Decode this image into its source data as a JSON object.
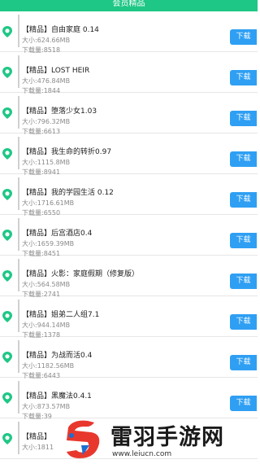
{
  "header": {
    "title": "会员精品"
  },
  "download_label": "下载",
  "colors": {
    "header_bg": "#1ec785",
    "button_bg": "#2f9ff3",
    "pin": "#1ec785"
  },
  "items": [
    {
      "name": "【精品】自由家庭 0.14",
      "size": "大小:624.66MB",
      "downloads": "下载量:8518"
    },
    {
      "name": "【精品】LOST HEIR",
      "size": "大小:476.84MB",
      "downloads": "下载量:1844"
    },
    {
      "name": "【精品】堕落少女1.03",
      "size": "大小:796.32MB",
      "downloads": "下载量:6613"
    },
    {
      "name": "【精品】我生命的转折0.97",
      "size": "大小:1115.8MB",
      "downloads": "下载量:8941"
    },
    {
      "name": "【精品】我的学园生活 0.12",
      "size": "大小:1716.61MB",
      "downloads": "下载量:6550"
    },
    {
      "name": "【精品】后宫酒店0.4",
      "size": "大小:1659.39MB",
      "downloads": "下载量:8451"
    },
    {
      "name": "【精品】火影：家庭假期（修复版）",
      "size": "大小:564.58MB",
      "downloads": "下载量:2741"
    },
    {
      "name": "【精品】姐弟二人组7.1",
      "size": "大小:944.14MB",
      "downloads": "下载量:1378"
    },
    {
      "name": "【精品】为战而活0.4",
      "size": "大小:1182.56MB",
      "downloads": "下载量:6443"
    },
    {
      "name": "【精品】黑魔法0.4.1",
      "size": "大小:873.57MB",
      "downloads": "下载量:39"
    },
    {
      "name": "【精品】",
      "size": "大小:1811",
      "downloads": ""
    }
  ],
  "watermark": {
    "title": "雷羽手游网",
    "url": "www.leiucn.com"
  }
}
